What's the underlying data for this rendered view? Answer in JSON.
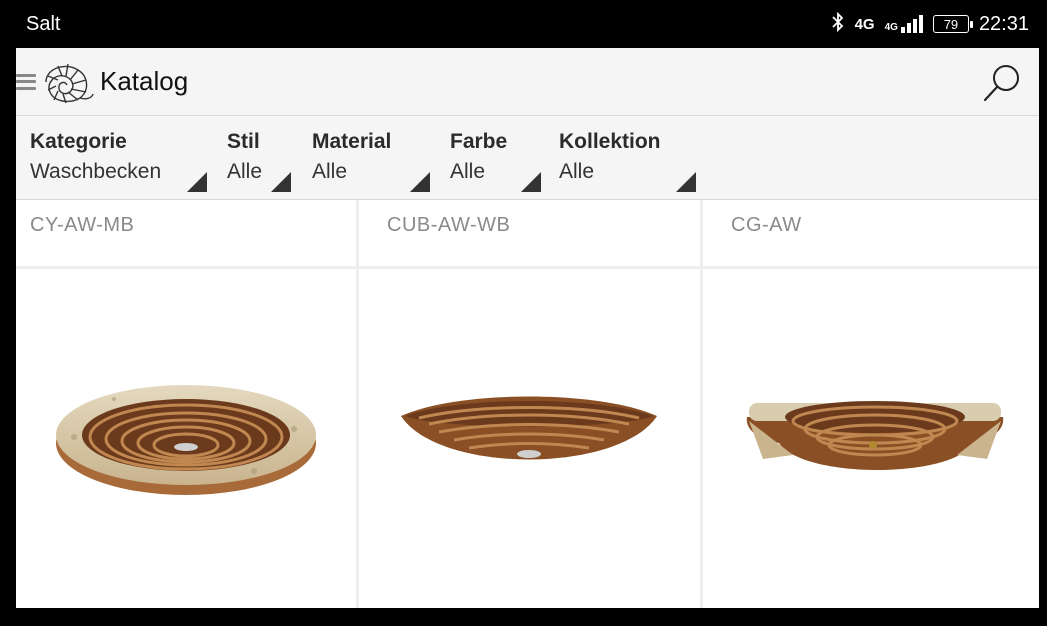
{
  "statusbar": {
    "carrier": "Salt",
    "network": "4G",
    "network2": "4G",
    "battery": "79",
    "time": "22:31"
  },
  "appbar": {
    "title": "Katalog"
  },
  "filters": [
    {
      "label": "Kategorie",
      "value": "Waschbecken"
    },
    {
      "label": "Stil",
      "value": "Alle"
    },
    {
      "label": "Material",
      "value": "Alle"
    },
    {
      "label": "Farbe",
      "value": "Alle"
    },
    {
      "label": "Kollektion",
      "value": "Alle"
    }
  ],
  "products_top": [
    {
      "sku": "CY-AW-MB"
    },
    {
      "sku": "CUB-AW-WB"
    },
    {
      "sku": "CG-AW"
    }
  ],
  "colors": {
    "wood_dark": "#6b3a1c",
    "wood_mid": "#9a5a2a",
    "wood_light": "#c08850",
    "stone": "#d9cdb0"
  }
}
